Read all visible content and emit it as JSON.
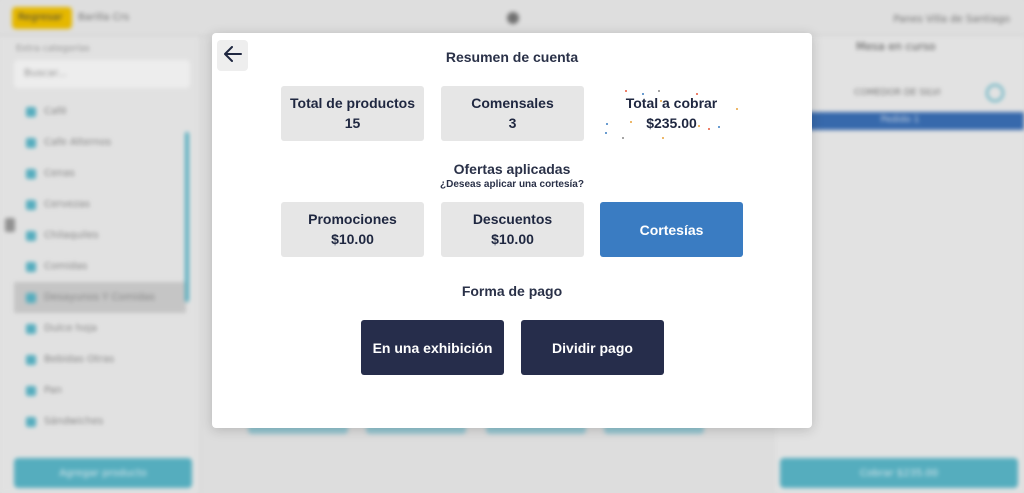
{
  "background": {
    "topbar": {
      "back_label": "Regresar",
      "app_title": "Barilla Crs",
      "branch": "Panes Villa de Santiago"
    },
    "sidebar": {
      "section_label": "Extra categorías",
      "search_placeholder": "Buscar...",
      "items": [
        "Café",
        "Cafe Alternos",
        "Cenas",
        "Cervezas",
        "Chilaquiles",
        "Comidas",
        "Desayunos Y Comidas",
        "Dulce hoja",
        "Bebidas Otras",
        "Pan",
        "Sándwiches"
      ],
      "active_index": 6,
      "bottom_button": "Agregar producto"
    },
    "right_panel": {
      "title": "Mesa en curso",
      "subtitle": "COMEDOR DE SILVI",
      "band_label": "Pedido 1",
      "bottom_button": "Cobrar $235.00"
    }
  },
  "modal": {
    "title": "Resumen de cuenta",
    "summary": [
      {
        "label": "Total de productos",
        "value": "15"
      },
      {
        "label": "Comensales",
        "value": "3"
      },
      {
        "label": "Total a cobrar",
        "value": "$235.00"
      }
    ],
    "offers_title": "Ofertas aplicadas",
    "offers_question": "¿Deseas aplicar una cortesía?",
    "offers": [
      {
        "label": "Promociones",
        "value": "$10.00"
      },
      {
        "label": "Descuentos",
        "value": "$10.00"
      },
      {
        "label": "Cortesías",
        "value": ""
      }
    ],
    "payment_title": "Forma de pago",
    "payment_options": [
      "En una exhibición",
      "Dividir pago"
    ]
  },
  "colors": {
    "primary_dark": "#262d4b",
    "accent_blue": "#3a7cc2",
    "card_gray": "#e6e6e6",
    "heading_text": "#2a3148"
  },
  "icons": {
    "back": "arrow-left-icon"
  }
}
